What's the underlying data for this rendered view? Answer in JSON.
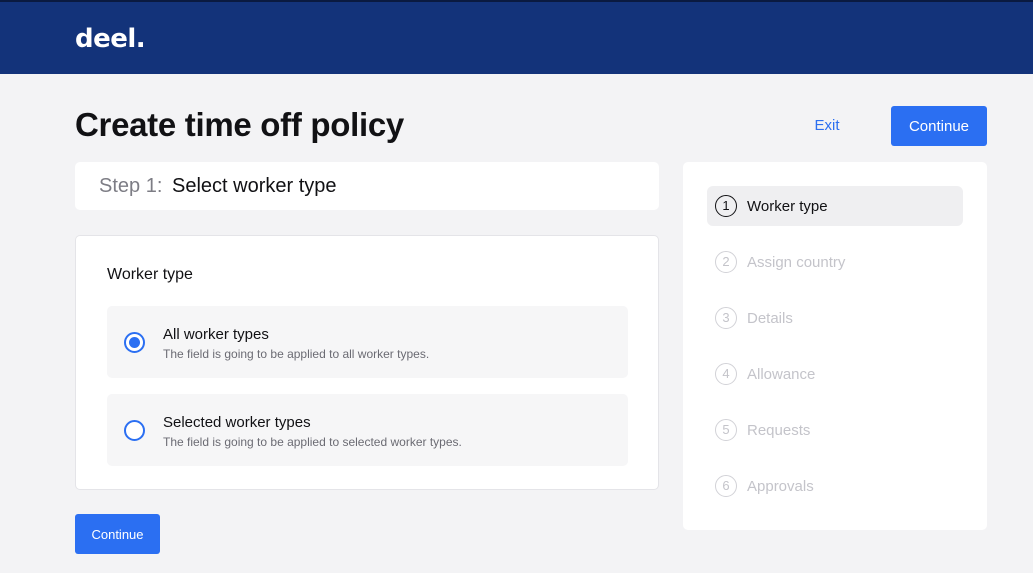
{
  "header": {
    "logo_text": "deel."
  },
  "page": {
    "title": "Create time off policy",
    "exit_label": "Exit",
    "continue_label": "Continue"
  },
  "step": {
    "prefix": "Step 1:",
    "name": "Select worker type"
  },
  "form": {
    "section_label": "Worker type",
    "options": [
      {
        "title": "All worker types",
        "description": "The field is going to be applied to all worker types.",
        "selected": true
      },
      {
        "title": "Selected worker types",
        "description": "The field is going to be applied to selected worker types.",
        "selected": false
      }
    ],
    "continue_label": "Continue"
  },
  "stepper": {
    "items": [
      {
        "number": "1",
        "label": "Worker type",
        "active": true
      },
      {
        "number": "2",
        "label": "Assign country",
        "active": false
      },
      {
        "number": "3",
        "label": "Details",
        "active": false
      },
      {
        "number": "4",
        "label": "Allowance",
        "active": false
      },
      {
        "number": "5",
        "label": "Requests",
        "active": false
      },
      {
        "number": "6",
        "label": "Approvals",
        "active": false
      }
    ]
  },
  "colors": {
    "header_bg": "#13337a",
    "primary": "#2b6ff2",
    "page_bg": "#f3f3f5"
  }
}
